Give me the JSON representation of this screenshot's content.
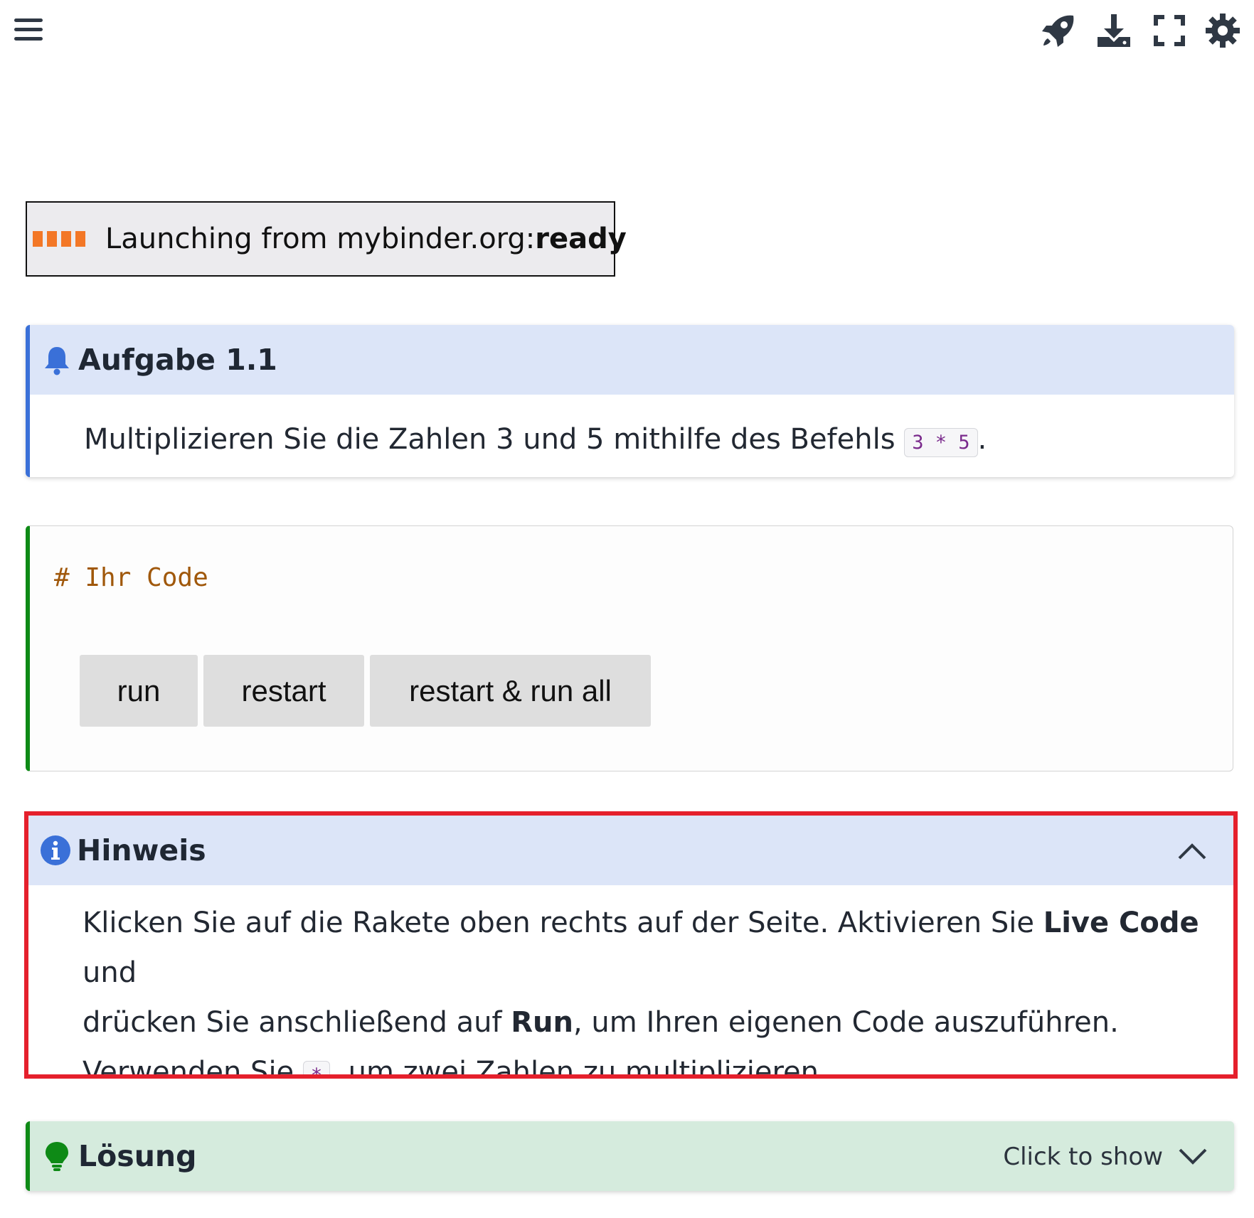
{
  "header": {
    "icons": [
      "menu-icon",
      "rocket-icon",
      "download-icon",
      "fullscreen-icon",
      "gear-icon"
    ]
  },
  "thebe": {
    "status_prefix": "Launching from mybinder.org: ",
    "status_value": "ready",
    "accent_color": "#f37726"
  },
  "task": {
    "title": "Aufgabe 1.1",
    "text_before": "Multiplizieren Sie die Zahlen 3 und 5 mithilfe des Befehls ",
    "code": "3 * 5",
    "text_after": ".",
    "icon": "bell-icon",
    "accent_color": "#3a70d8"
  },
  "code_cell": {
    "code": "# Ihr Code",
    "buttons": [
      "run",
      "restart",
      "restart & run all"
    ],
    "accent_color": "#0e8a16"
  },
  "hint": {
    "title": "Hinweis",
    "icon": "info-icon",
    "line1_a": "Klicken Sie auf die Rakete oben rechts auf der Seite. Aktivieren Sie ",
    "line1_b": "Live Code",
    "line1_c": " und",
    "line2_a": "drücken Sie anschließend auf ",
    "line2_b": "Run",
    "line2_c": ", um Ihren eigenen Code auszuführen.",
    "line3_a": "Verwenden Sie ",
    "line3_code": "*",
    "line3_c": ", um zwei Zahlen zu multiplizieren.",
    "highlight_color": "#e5202c"
  },
  "solution": {
    "title": "Lösung",
    "toggle_label": "Click to show",
    "icon": "lightbulb-icon"
  }
}
